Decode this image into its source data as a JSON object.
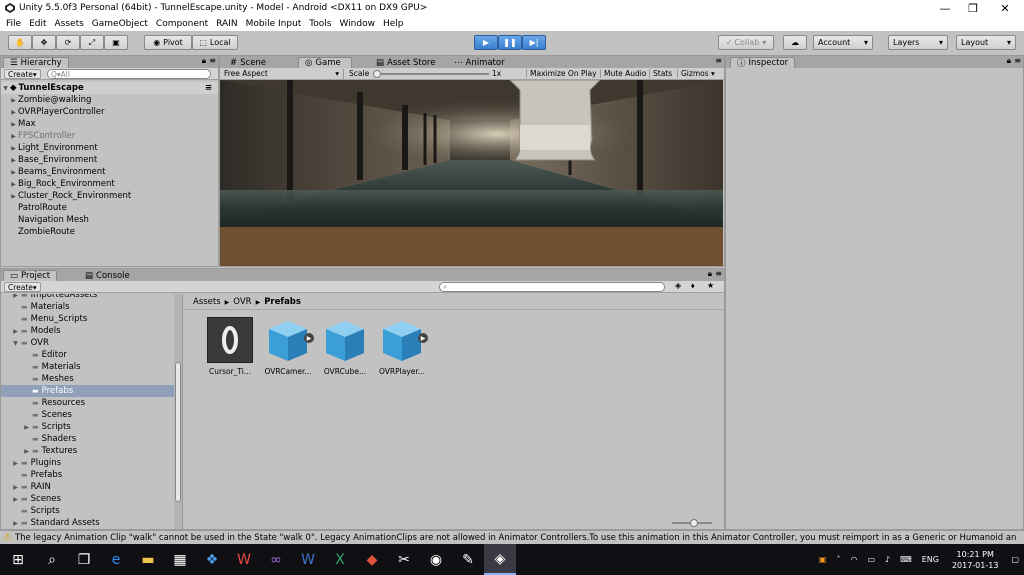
{
  "window": {
    "title": "Unity 5.5.0f3 Personal (64bit) - TunnelEscape.unity - Model - Android <DX11 on DX9 GPU>",
    "minimize": "—",
    "maximize": "❐",
    "close": "✕"
  },
  "menu": [
    "File",
    "Edit",
    "Assets",
    "GameObject",
    "Component",
    "RAIN",
    "Mobile Input",
    "Tools",
    "Window",
    "Help"
  ],
  "toolbar": {
    "pivot": "Pivot",
    "local": "Local",
    "collab": "Collab",
    "account": "Account",
    "layers": "Layers",
    "layout": "Layout"
  },
  "hierarchy": {
    "tab": "Hierarchy",
    "create": "Create",
    "search_placeholder": "Q▾All",
    "scene": "TunnelEscape",
    "items": [
      {
        "label": "Zombie@walking",
        "arrow": "▶",
        "muted": false
      },
      {
        "label": "OVRPlayerController",
        "arrow": "▶",
        "muted": false
      },
      {
        "label": "Max",
        "arrow": "▶",
        "muted": false
      },
      {
        "label": "FPSController",
        "arrow": "▶",
        "muted": true
      },
      {
        "label": "Light_Environment",
        "arrow": "▶",
        "muted": false
      },
      {
        "label": "Base_Environment",
        "arrow": "▶",
        "muted": false
      },
      {
        "label": "Beams_Environment",
        "arrow": "▶",
        "muted": false
      },
      {
        "label": "Big_Rock_Environment",
        "arrow": "▶",
        "muted": false
      },
      {
        "label": "Cluster_Rock_Environment",
        "arrow": "▶",
        "muted": false
      },
      {
        "label": "PatrolRoute",
        "arrow": "",
        "muted": false
      },
      {
        "label": "Navigation Mesh",
        "arrow": "",
        "muted": false
      },
      {
        "label": "ZombieRoute",
        "arrow": "",
        "muted": false
      }
    ]
  },
  "center_tabs": {
    "scene": "Scene",
    "game": "Game",
    "asset_store": "Asset Store",
    "animator": "Animator"
  },
  "game_bar": {
    "aspect": "Free Aspect",
    "scale_label": "Scale",
    "scale_value": "1x",
    "maximize": "Maximize On Play",
    "mute": "Mute Audio",
    "stats": "Stats",
    "gizmos": "Gizmos"
  },
  "inspector": {
    "tab": "Inspector"
  },
  "project": {
    "tab": "Project",
    "console_tab": "Console",
    "create": "Create",
    "breadcrumb": [
      "Assets",
      "OVR",
      "Prefabs"
    ],
    "tree": [
      {
        "label": "ImportedAssets",
        "arrow": "▶",
        "indent": 0,
        "selected": false
      },
      {
        "label": "Materials",
        "arrow": "",
        "indent": 0,
        "selected": false
      },
      {
        "label": "Menu_Scripts",
        "arrow": "",
        "indent": 0,
        "selected": false
      },
      {
        "label": "Models",
        "arrow": "▶",
        "indent": 0,
        "selected": false
      },
      {
        "label": "OVR",
        "arrow": "▼",
        "indent": 0,
        "selected": false
      },
      {
        "label": "Editor",
        "arrow": "",
        "indent": 1,
        "selected": false
      },
      {
        "label": "Materials",
        "arrow": "",
        "indent": 1,
        "selected": false
      },
      {
        "label": "Meshes",
        "arrow": "",
        "indent": 1,
        "selected": false
      },
      {
        "label": "Prefabs",
        "arrow": "",
        "indent": 1,
        "selected": true
      },
      {
        "label": "Resources",
        "arrow": "",
        "indent": 1,
        "selected": false
      },
      {
        "label": "Scenes",
        "arrow": "",
        "indent": 1,
        "selected": false
      },
      {
        "label": "Scripts",
        "arrow": "▶",
        "indent": 1,
        "selected": false
      },
      {
        "label": "Shaders",
        "arrow": "",
        "indent": 1,
        "selected": false
      },
      {
        "label": "Textures",
        "arrow": "▶",
        "indent": 1,
        "selected": false
      },
      {
        "label": "Plugins",
        "arrow": "▶",
        "indent": 0,
        "selected": false
      },
      {
        "label": "Prefabs",
        "arrow": "",
        "indent": 0,
        "selected": false
      },
      {
        "label": "RAIN",
        "arrow": "▶",
        "indent": 0,
        "selected": false
      },
      {
        "label": "Scenes",
        "arrow": "▶",
        "indent": 0,
        "selected": false
      },
      {
        "label": "Scripts",
        "arrow": "",
        "indent": 0,
        "selected": false
      },
      {
        "label": "Standard Assets",
        "arrow": "▶",
        "indent": 0,
        "selected": false
      }
    ],
    "assets": [
      {
        "label": "Cursor_Ti...",
        "kind": "cursor"
      },
      {
        "label": "OVRCamer...",
        "kind": "cube"
      },
      {
        "label": "OVRCube...",
        "kind": "cube"
      },
      {
        "label": "OVRPlayer...",
        "kind": "cube"
      }
    ]
  },
  "status": {
    "message": "The legacy Animation Clip \"walk\" cannot be used in the State \"walk 0\". Legacy AnimationClips are not allowed in Animator Controllers.To use this animation in this Animator Controller, you must reimport in as a Generic or Humanoid an"
  },
  "taskbar": {
    "language": "ENG",
    "time": "10:21 PM",
    "date": "2017-01-13"
  },
  "colors": {
    "accent_play": "#3b7fd1",
    "panel_bg": "#c2c2c2",
    "selection": "#8fa0b8",
    "taskbar_bg": "#101014"
  }
}
